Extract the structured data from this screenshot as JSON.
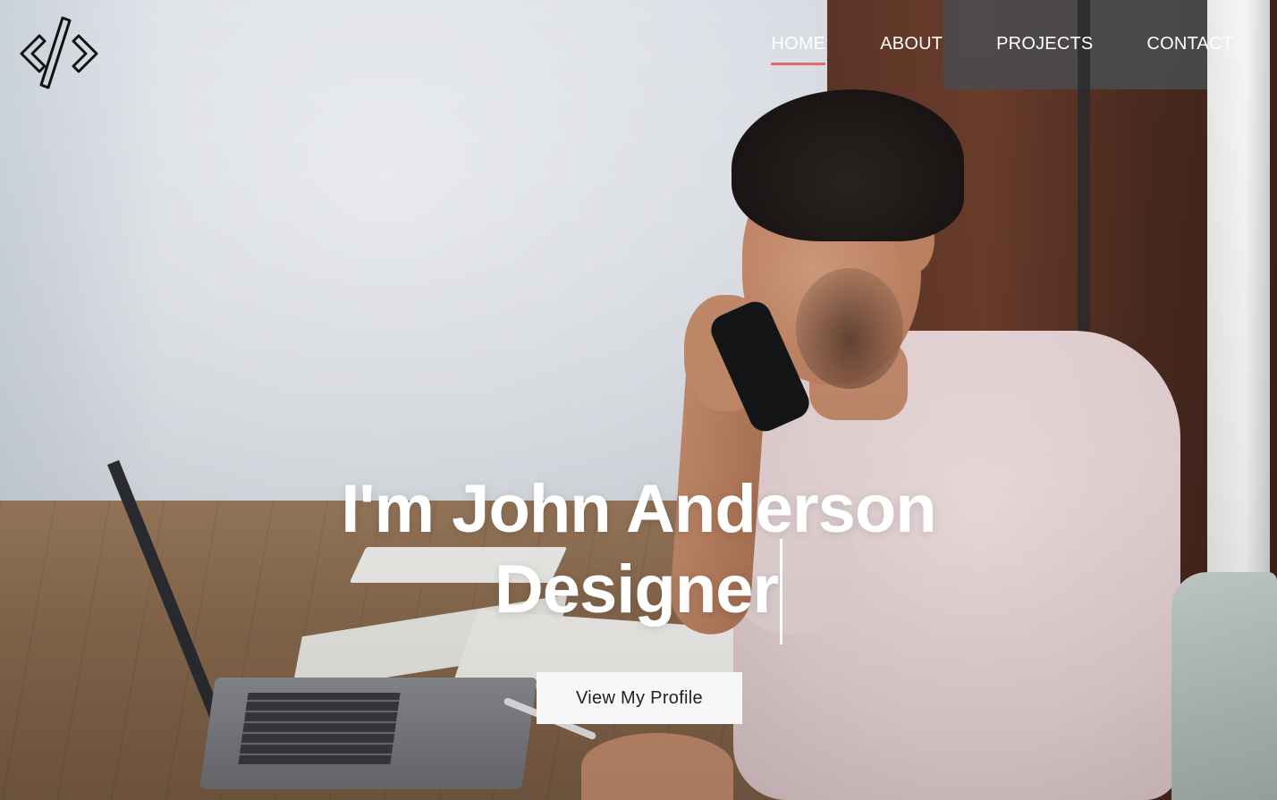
{
  "nav": {
    "items": [
      {
        "label": "HOME",
        "active": true
      },
      {
        "label": "ABOUT",
        "active": false
      },
      {
        "label": "PROJECTS",
        "active": false
      },
      {
        "label": "CONTACT",
        "active": false
      }
    ],
    "active_color": "#e8676a"
  },
  "logo": {
    "icon": "code-brackets-icon"
  },
  "hero": {
    "greeting": "I'm John Anderson",
    "role": "Designer",
    "cta_label": "View My Profile"
  }
}
